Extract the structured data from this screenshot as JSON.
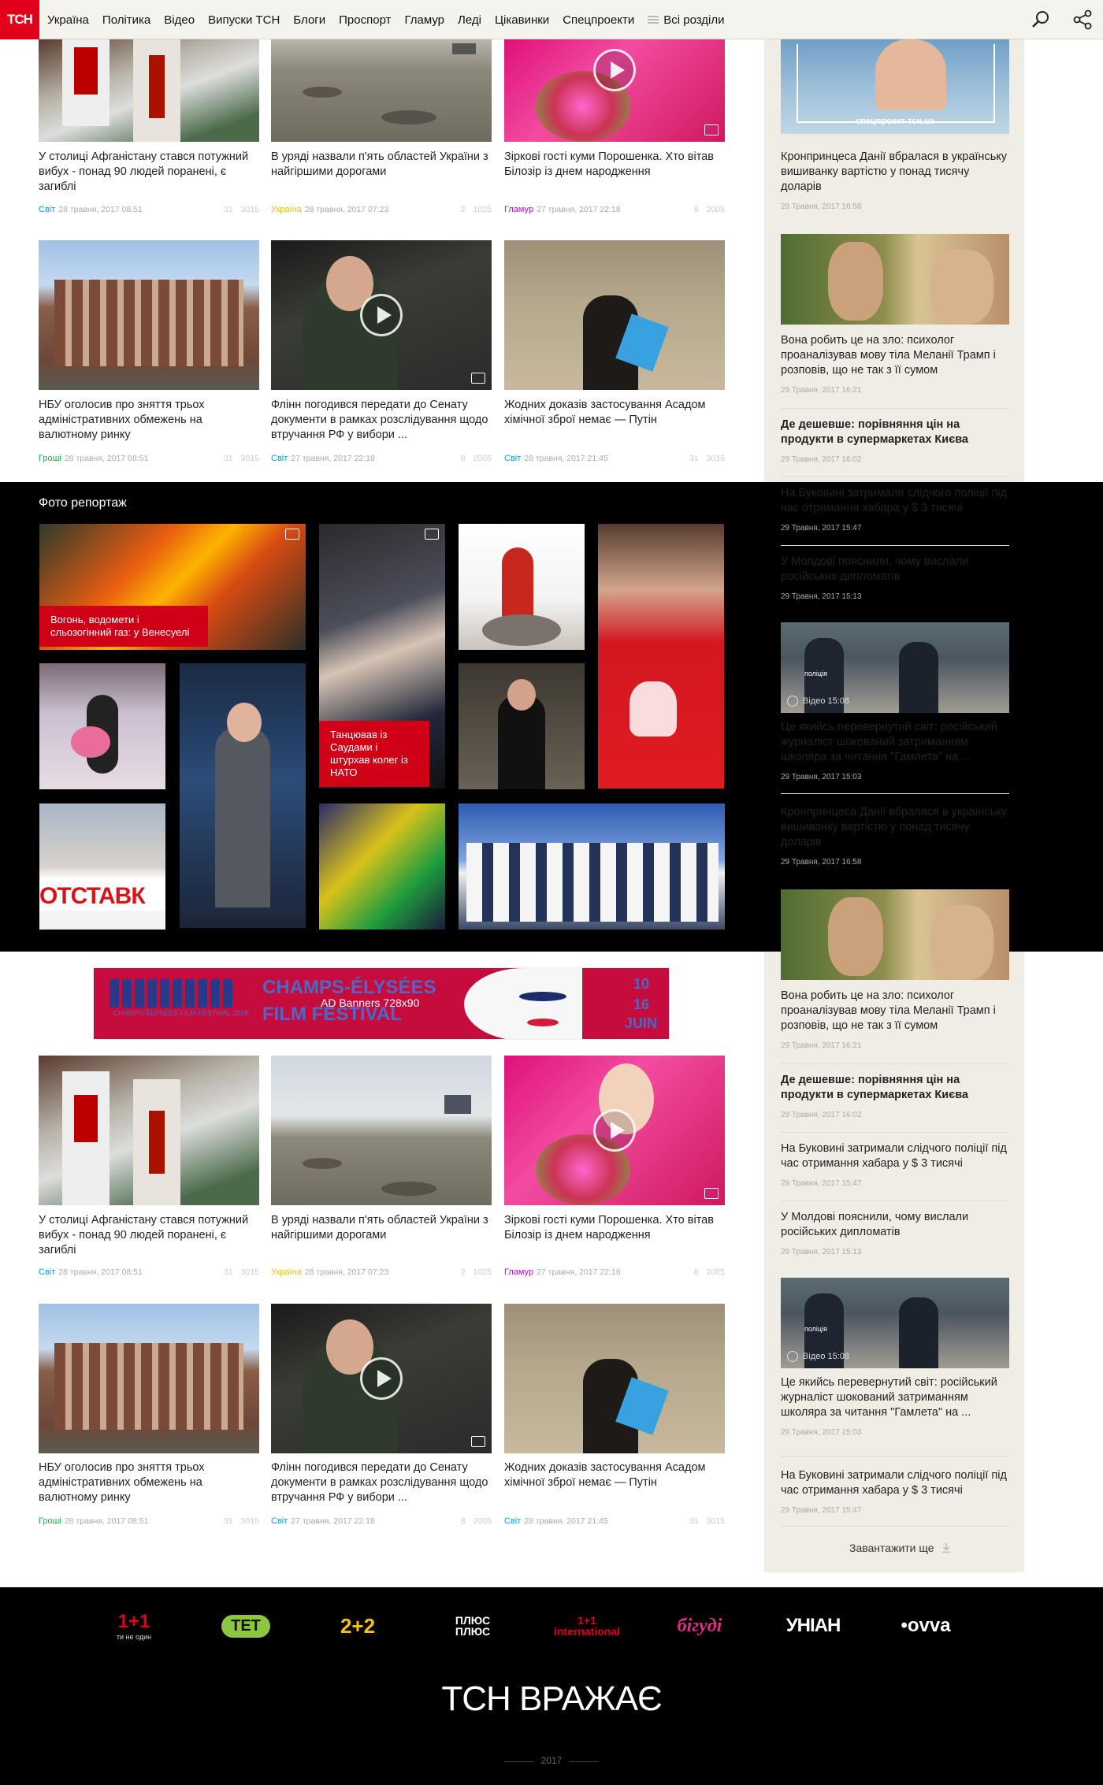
{
  "header": {
    "logo": "ТСН",
    "nav": [
      "Україна",
      "Політика",
      "Відео",
      "Випуски ТСН",
      "Блоги",
      "Проспорт",
      "Гламур",
      "Леді",
      "Цікавинки",
      "Спецпроекти"
    ],
    "all_sections": "Всі розділи"
  },
  "news_top": [
    {
      "title": "У столиці Афганістану стався потужний вибух - понад 90 людей поранені, є загиблі",
      "category": "Світ",
      "cat_color": "#00a0e6",
      "date": "28 травня, 2017 08:51",
      "comments": "31",
      "views": "3015",
      "video": false
    },
    {
      "title": "В уряді назвали п'ять областей України з найгіршими дорогами",
      "category": "Україна",
      "cat_color": "#f0c000",
      "date": "28 травня, 2017 07:23",
      "comments": "2",
      "views": "1025",
      "video": false
    },
    {
      "title": "Зіркові гості куми Порошенка. Хто вітав Білозір із днем народження",
      "category": "Гламур",
      "cat_color": "#b20fc8",
      "date": "27 травня, 2017 22:18",
      "comments": "8",
      "views": "2005",
      "video": true
    },
    {
      "title": "НБУ оголосив про зняття трьох адміністративних обмежень на валютному ринку",
      "category": "Гроші",
      "cat_color": "#12b04a",
      "date": "28 травня, 2017 08:51",
      "comments": "31",
      "views": "3015",
      "video": false
    },
    {
      "title": "Флінн погодився передати до Сенату документи в рамках розслідування щодо втручання РФ у вибори ...",
      "category": "Світ",
      "cat_color": "#00a0e6",
      "date": "27 травня, 2017 22:18",
      "comments": "8",
      "views": "2005",
      "video": true
    },
    {
      "title": "Жодних доказів застосування Асадом хімічної зброї немає — Путін",
      "category": "Світ",
      "cat_color": "#00a0e6",
      "date": "28 травня, 2017 21:45",
      "comments": "31",
      "views": "3015",
      "video": false
    }
  ],
  "photo_section": {
    "title": "Фото репортаж",
    "caption1": "Вогонь, водомети і сльозогінний газ: у Венесуелі",
    "caption2": "Танцював із Саудами і штурхав колег із НАТО"
  },
  "ad": {
    "label": "AD Banners 728х90",
    "title1": "CHAMPS-ÉLYSÉES",
    "title2": "FILM FESTIVAL",
    "d1": "10",
    "d2": "16",
    "d3": "JUIN",
    "small": "CHAMPS-ÉLYSÉES FILM FESTIVAL 2018"
  },
  "sidebar": {
    "top_banner": "спецпроект тсн.ua",
    "items": [
      {
        "title": "Кронпринцеса Данії вбралася в українську вишиванку вартістю у понад тисячу доларів",
        "date": "29 Травня, 2017 16:58",
        "bold": false
      },
      {
        "title": "Вона робить це на зло: психолог проаналізував мову тіла Меланії Трамп і розповів, що не так з її сумом",
        "date": "29 Травня, 2017 16:21",
        "bold": false
      },
      {
        "title": "Де дешевше: порівняння цін на продукти в супермаркетах Києва",
        "date": "29 Травня, 2017 16:02",
        "bold": true
      },
      {
        "title": "На Буковині затримали слідчого поліції під час отримання хабара у $ 3 тисячі",
        "date": "29 Травня, 2017 15:47",
        "bold": false
      },
      {
        "title": "У Молдові пояснили, чому вислали російських дипломатів",
        "date": "29 Травня, 2017 15:13",
        "bold": false
      },
      {
        "title": "Це якийсь перевернутий світ: російський журналіст шокований затриманням школяра за читання \"Гамлета\" на ...",
        "date": "29 Травня, 2017 15:03",
        "bold": false
      },
      {
        "title": "Кронпринцеса Данії вбралася в українську вишиванку вартістю у понад тисячу доларів",
        "date": "29 Травня, 2017 16:58",
        "bold": false
      },
      {
        "title": "Вона робить це на зло: психолог проаналізував мову тіла Меланії Трамп і розповів, що не так з її сумом",
        "date": "29 Травня, 2017 16:21",
        "bold": false
      },
      {
        "title": "Де дешевше: порівняння цін на продукти в супермаркетах Києва",
        "date": "29 Травня, 2017 16:02",
        "bold": true
      },
      {
        "title": "На Буковині затримали слідчого поліції під час отримання хабара у $ 3 тисячі",
        "date": "29 Травня, 2017 15:47",
        "bold": false
      },
      {
        "title": "У Молдові пояснили, чому вислали російських дипломатів",
        "date": "29 Травня, 2017 15:13",
        "bold": false
      },
      {
        "title": "Це якийсь перевернутий світ: російський журналіст шокований затриманням школяра за читання \"Гамлета\" на ...",
        "date": "29 Травня, 2017 15:03",
        "bold": false
      },
      {
        "title": "На Буковині затримали слідчого поліції під час отримання хабара у $ 3 тисячі",
        "date": "29 Травня, 2017 15:47",
        "bold": false
      }
    ],
    "video_label": "Відео 15:08",
    "police": "поліція",
    "load_more": "Завантажити ще"
  },
  "footer": {
    "channels": [
      "1+1",
      "ТЕТ",
      "2+2",
      "ПЛЮС ПЛЮС",
      "1+1 international",
      "бігуді",
      "УНІАН",
      "ovva"
    ],
    "channel_sub": "ти не один",
    "title": "ТСН ВРАЖАЄ",
    "year": "2017"
  }
}
